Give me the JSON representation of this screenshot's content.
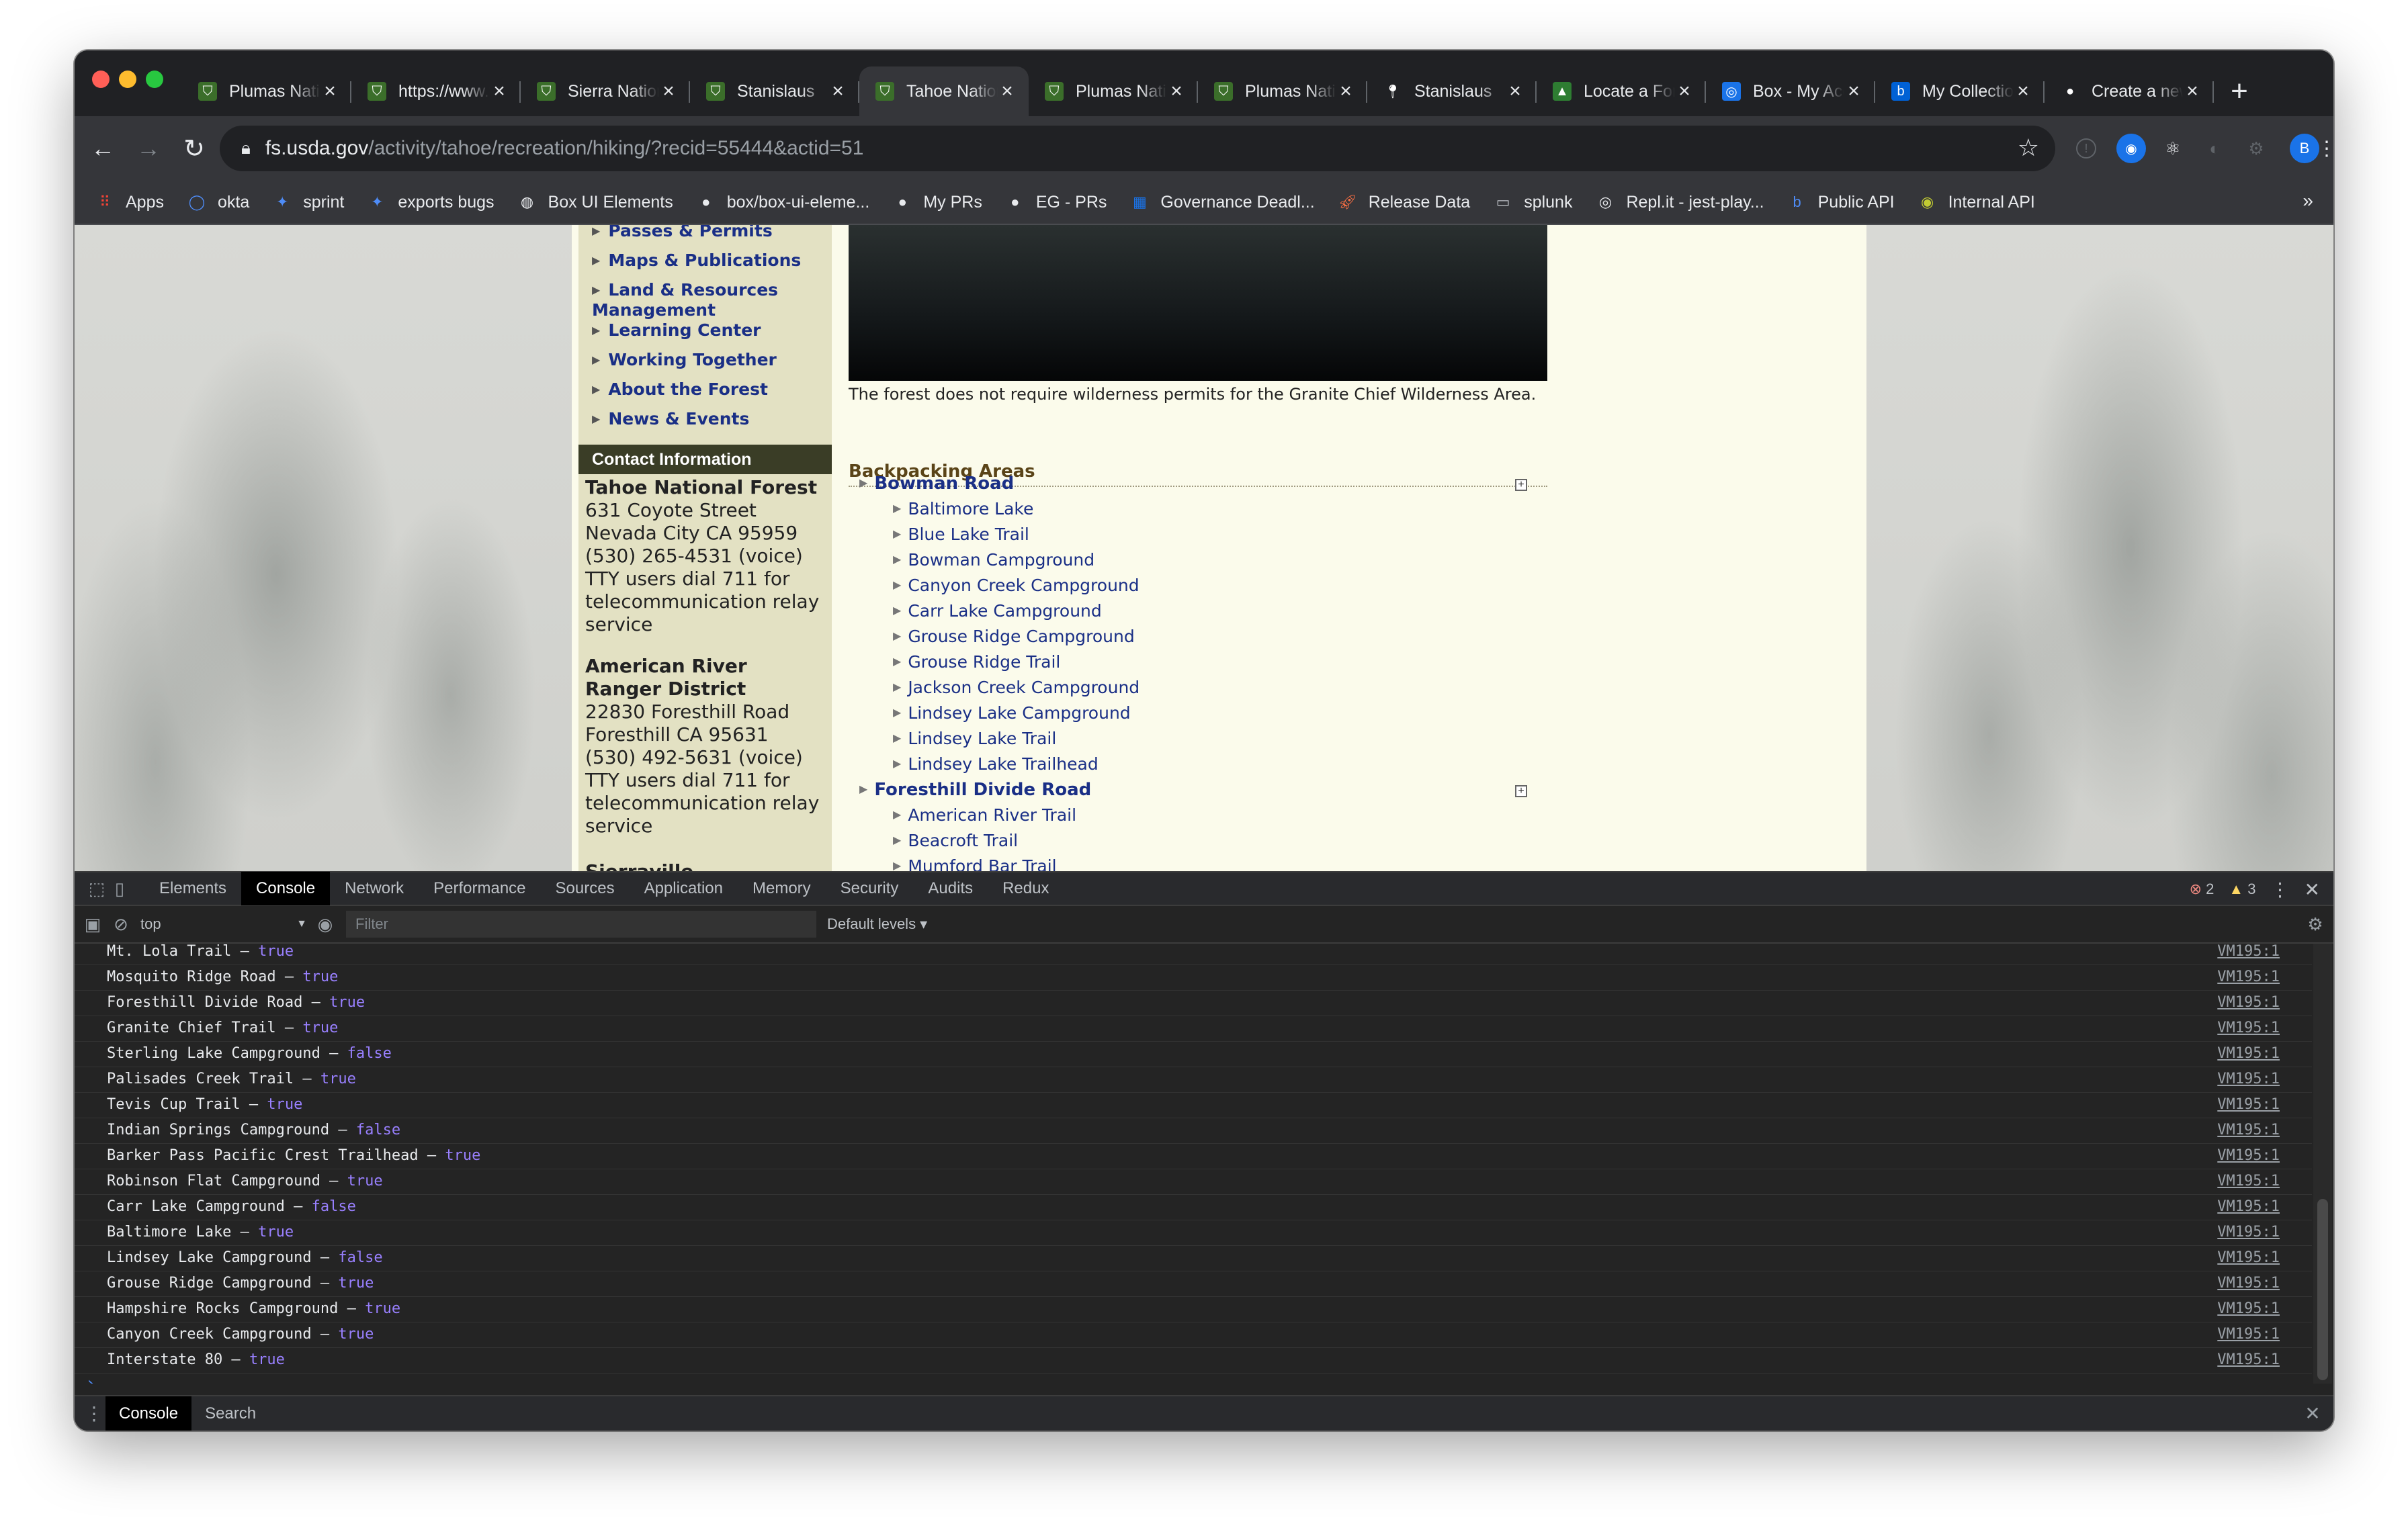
{
  "colors": {
    "accent": "#1a2f86",
    "chrome_bg": "#202124",
    "toolbar_bg": "#35363a",
    "devtools_bg": "#242424",
    "bool_value": "#9980ff"
  },
  "window": {
    "tabs": [
      {
        "title": "Plumas National Forest",
        "icon": "forest-service-icon",
        "active": false
      },
      {
        "title": "https://www.fs.usda.gov",
        "icon": "forest-service-icon",
        "active": false
      },
      {
        "title": "Sierra National Forest",
        "icon": "forest-service-icon",
        "active": false
      },
      {
        "title": "Stanislaus",
        "icon": "forest-service-icon",
        "active": false
      },
      {
        "title": "Tahoe National Forest",
        "icon": "forest-service-icon",
        "active": true
      },
      {
        "title": "Plumas National Forest",
        "icon": "forest-service-icon",
        "active": false
      },
      {
        "title": "Plumas National Forest",
        "icon": "forest-service-icon",
        "active": false
      },
      {
        "title": "Stanislaus",
        "icon": "maps-pin-icon",
        "active": false
      },
      {
        "title": "Locate a Forest",
        "icon": "tree-icon",
        "active": false
      },
      {
        "title": "Box - My Account",
        "icon": "box-circle-icon",
        "active": false
      },
      {
        "title": "My Collections",
        "icon": "box-logo-icon",
        "active": false
      },
      {
        "title": "Create a new",
        "icon": "github-icon",
        "active": false
      }
    ],
    "url_host": "fs.usda.gov",
    "url_path": "/activity/tahoe/recreation/hiking/?recid=55444&actid=51",
    "profile_initial": "B"
  },
  "bookmarks": [
    {
      "label": "Apps",
      "icon": "apps-grid-icon"
    },
    {
      "label": "okta",
      "icon": "okta-icon"
    },
    {
      "label": "sprint",
      "icon": "jira-icon"
    },
    {
      "label": "exports bugs",
      "icon": "jira-icon"
    },
    {
      "label": "Box UI Elements",
      "icon": "globe-icon"
    },
    {
      "label": "box/box-ui-eleme...",
      "icon": "github-icon"
    },
    {
      "label": "My PRs",
      "icon": "github-icon"
    },
    {
      "label": "EG - PRs",
      "icon": "github-icon"
    },
    {
      "label": "Governance Deadl...",
      "icon": "grid-icon"
    },
    {
      "label": "Release Data",
      "icon": "rocket-icon"
    },
    {
      "label": "splunk",
      "icon": "folder-icon"
    },
    {
      "label": "Repl.it - jest-play...",
      "icon": "replit-icon"
    },
    {
      "label": "Public API",
      "icon": "box-logo-icon"
    },
    {
      "label": "Internal API",
      "icon": "circle-icon"
    }
  ],
  "page": {
    "nav_items": [
      "Passes & Permits",
      "Maps & Publications",
      "Land & Resources Management",
      "Learning Center",
      "Working Together",
      "About the Forest",
      "News & Events"
    ],
    "contact_heading": "Contact Information",
    "office1": {
      "name": "Tahoe National Forest",
      "lines": [
        "631 Coyote Street",
        "Nevada City CA 95959",
        "(530) 265-4531 (voice)",
        "TTY users dial 711 for",
        "telecommunication relay",
        "service"
      ]
    },
    "office2": {
      "name_lines": [
        "American River",
        "Ranger District"
      ],
      "lines": [
        "22830 Foresthill Road",
        "Foresthill CA 95631",
        "(530) 492-5631 (voice)",
        "TTY users dial 711 for",
        "telecommunication relay",
        "service"
      ]
    },
    "office3_partial": "Sierraville",
    "caption": "The forest does not require wilderness permits for the Granite Chief Wilderness Area.",
    "section_title": "Backpacking Areas",
    "areas": [
      {
        "name": "Bowman Road",
        "items": [
          "Baltimore Lake",
          "Blue Lake Trail",
          "Bowman Campground",
          "Canyon Creek Campground",
          "Carr Lake Campground",
          "Grouse Ridge Campground",
          "Grouse Ridge Trail",
          "Jackson Creek Campground",
          "Lindsey Lake Campground",
          "Lindsey Lake Trail",
          "Lindsey Lake Trailhead"
        ]
      },
      {
        "name": "Foresthill Divide Road",
        "items": [
          "American River Trail",
          "Beacroft Trail",
          "Mumford Bar Trail"
        ]
      }
    ]
  },
  "devtools": {
    "tabs": [
      "Elements",
      "Console",
      "Network",
      "Performance",
      "Sources",
      "Application",
      "Memory",
      "Security",
      "Audits",
      "Redux"
    ],
    "active_tab": "Console",
    "error_count": "2",
    "warning_count": "3",
    "context": "top",
    "filter_placeholder": "Filter",
    "levels": "Default levels ▾",
    "logs": [
      {
        "text": "Mt. Lola Trail –",
        "value": "true",
        "source": "VM195:1"
      },
      {
        "text": "Mosquito Ridge Road –",
        "value": "true",
        "source": "VM195:1"
      },
      {
        "text": "Foresthill Divide Road –",
        "value": "true",
        "source": "VM195:1"
      },
      {
        "text": "Granite Chief Trail –",
        "value": "true",
        "source": "VM195:1"
      },
      {
        "text": "Sterling Lake Campground –",
        "value": "false",
        "source": "VM195:1"
      },
      {
        "text": "Palisades Creek Trail –",
        "value": "true",
        "source": "VM195:1"
      },
      {
        "text": "Tevis Cup Trail –",
        "value": "true",
        "source": "VM195:1"
      },
      {
        "text": "Indian Springs Campground –",
        "value": "false",
        "source": "VM195:1"
      },
      {
        "text": "Barker Pass Pacific Crest Trailhead –",
        "value": "true",
        "source": "VM195:1"
      },
      {
        "text": "Robinson Flat Campground –",
        "value": "true",
        "source": "VM195:1"
      },
      {
        "text": "Carr Lake Campground –",
        "value": "false",
        "source": "VM195:1"
      },
      {
        "text": "Baltimore Lake –",
        "value": "true",
        "source": "VM195:1"
      },
      {
        "text": "Lindsey Lake Campground –",
        "value": "false",
        "source": "VM195:1"
      },
      {
        "text": "Grouse Ridge Campground –",
        "value": "true",
        "source": "VM195:1"
      },
      {
        "text": "Hampshire Rocks Campground –",
        "value": "true",
        "source": "VM195:1"
      },
      {
        "text": "Canyon Creek Campground –",
        "value": "true",
        "source": "VM195:1"
      },
      {
        "text": "Interstate 80 –",
        "value": "true",
        "source": "VM195:1"
      }
    ],
    "prompt": "›",
    "drawer_tabs": [
      "Console",
      "Search"
    ]
  }
}
